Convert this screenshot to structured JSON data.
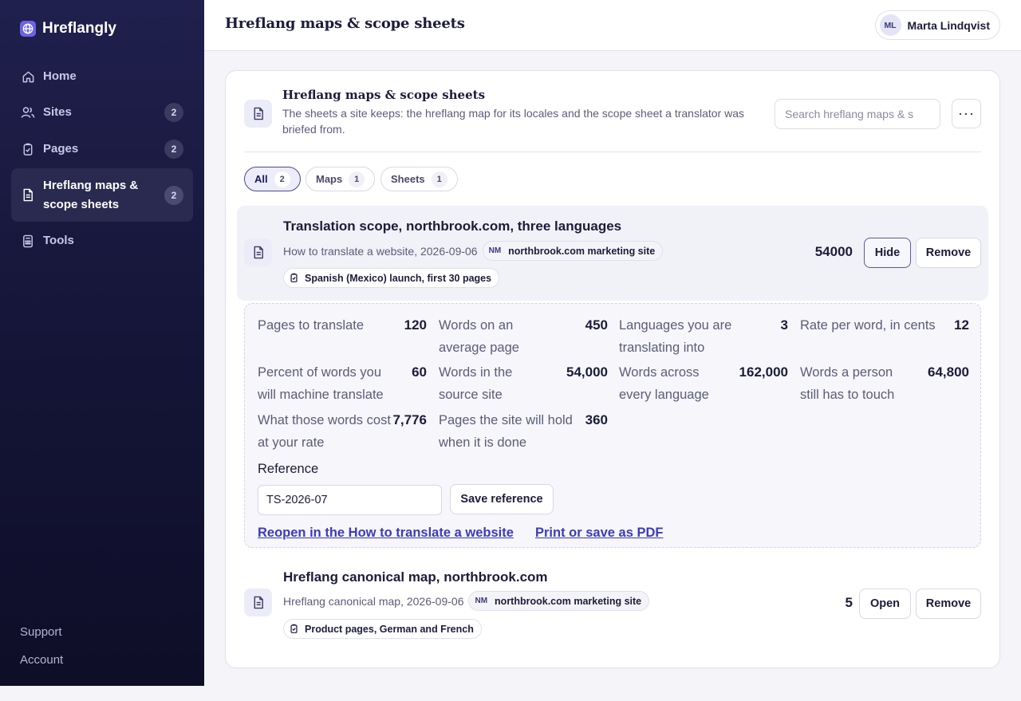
{
  "app": {
    "name": "Hreflangly"
  },
  "sidebar": {
    "items": [
      {
        "label": "Home",
        "icon": "home-icon"
      },
      {
        "label": "Sites",
        "badge": "2",
        "icon": "users-icon"
      },
      {
        "label": "Pages",
        "badge": "2",
        "icon": "clipboard-icon"
      },
      {
        "label": "Hreflang maps & scope sheets",
        "badge": "2",
        "icon": "document-icon",
        "active": true
      },
      {
        "label": "Tools",
        "icon": "calculator-icon"
      }
    ],
    "footer": {
      "support": "Support",
      "account": "Account"
    }
  },
  "header": {
    "title": "Hreflang maps & scope sheets",
    "user": {
      "initials": "ML",
      "name": "Marta Lindqvist"
    }
  },
  "card": {
    "title": "Hreflang maps & scope sheets",
    "description": "The sheets a site keeps: the hreflang map for its locales and the scope sheet a translator was briefed from.",
    "search_placeholder": "Search hreflang maps & s",
    "more_label": "···"
  },
  "filters": [
    {
      "label": "All",
      "count": "2",
      "active": true
    },
    {
      "label": "Maps",
      "count": "1"
    },
    {
      "label": "Sheets",
      "count": "1"
    }
  ],
  "items": [
    {
      "title": "Translation scope, northbrook.com, three languages",
      "meta": "How to translate a website, 2026-09-06",
      "site_initials": "NM",
      "site": "northbrook.com marketing site",
      "page": "Spanish (Mexico) launch, first 30 pages",
      "number": "54000",
      "primary_action": "Hide",
      "secondary_action": "Remove",
      "details": {
        "stats": [
          {
            "label": "Pages to translate",
            "value": "120"
          },
          {
            "label": "Words on an average page",
            "value": "450"
          },
          {
            "label": "Languages you are translating into",
            "value": "3"
          },
          {
            "label": "Rate per word, in cents",
            "value": "12"
          },
          {
            "label": "Percent of words you will machine translate",
            "value": "60"
          },
          {
            "label": "Words in the source site",
            "value": "54,000"
          },
          {
            "label": "Words across every language",
            "value": "162,000"
          },
          {
            "label": "Words a person still has to touch",
            "value": "64,800"
          },
          {
            "label": "What those words cost at your rate",
            "value": "7,776"
          },
          {
            "label": "Pages the site will hold when it is done",
            "value": "360"
          }
        ],
        "reference_label": "Reference",
        "reference_value": "TS-2026-07",
        "save_reference": "Save reference",
        "reopen_link": "Reopen in the How to translate a website",
        "print_link": "Print or save as PDF"
      }
    },
    {
      "title": "Hreflang canonical map, northbrook.com",
      "meta": "Hreflang canonical map, 2026-09-06",
      "site_initials": "NM",
      "site": "northbrook.com marketing site",
      "page": "Product pages, German and French",
      "number": "5",
      "primary_action": "Open",
      "secondary_action": "Remove"
    }
  ]
}
